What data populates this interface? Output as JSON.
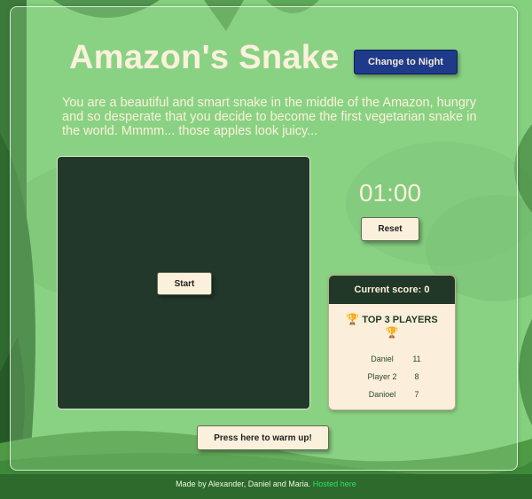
{
  "header": {
    "title": "Amazon's Snake",
    "night_button": "Change to Night"
  },
  "intro": "You are a beautiful and smart snake in the middle of the Amazon, hungry and so desperate that you decide to become the first vegetarian snake in the world. Mmmm... those apples look juicy...",
  "game": {
    "start_button": "Start",
    "timer": "01:00",
    "reset_button": "Reset",
    "warmup_button": "Press here to warm up!"
  },
  "scoreboard": {
    "current_score": "Current score: 0",
    "top_title": "TOP 3 PLAYERS",
    "players": [
      {
        "name": "Daniel",
        "score": "11"
      },
      {
        "name": "Player 2",
        "score": "8"
      },
      {
        "name": "Danioel",
        "score": "7"
      }
    ]
  },
  "footer": {
    "text": "Made by Alexander, Daniel and Maria.",
    "link": "Hosted here"
  },
  "colors": {
    "board": "#22382a",
    "night_button": "#1f3a8a",
    "cream": "#fbf0dc",
    "link": "#2ee06a"
  }
}
